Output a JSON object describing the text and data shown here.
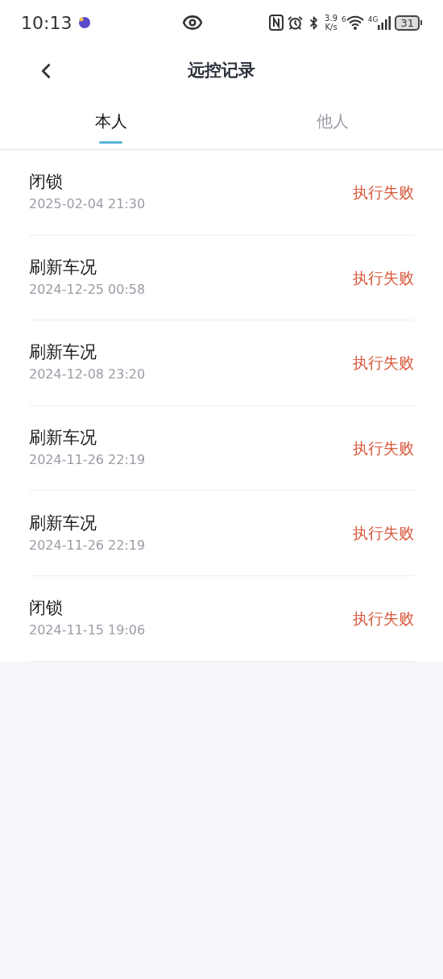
{
  "status_bar": {
    "time": "10:13",
    "net_speed": "3.9",
    "net_unit": "K/s",
    "wifi_label": "6",
    "cell_label": "4G",
    "battery": "31"
  },
  "header": {
    "title": "远控记录"
  },
  "tabs": [
    {
      "label": "本人",
      "selected": true
    },
    {
      "label": "他人",
      "selected": false
    }
  ],
  "records": [
    {
      "action": "闭锁",
      "time": "2025-02-04 21:30",
      "status": "执行失败"
    },
    {
      "action": "刷新车况",
      "time": "2024-12-25 00:58",
      "status": "执行失败"
    },
    {
      "action": "刷新车况",
      "time": "2024-12-08 23:20",
      "status": "执行失败"
    },
    {
      "action": "刷新车况",
      "time": "2024-11-26 22:19",
      "status": "执行失败"
    },
    {
      "action": "刷新车况",
      "time": "2024-11-26 22:19",
      "status": "执行失败"
    },
    {
      "action": "闭锁",
      "time": "2024-11-15 19:06",
      "status": "执行失败"
    }
  ]
}
